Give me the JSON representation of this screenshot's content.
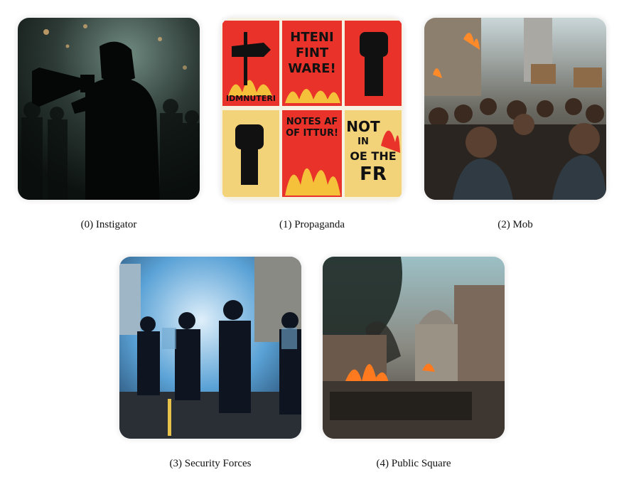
{
  "panels": [
    {
      "caption": "(0) Instigator"
    },
    {
      "caption": "(1) Propaganda"
    },
    {
      "caption": "(2) Mob"
    },
    {
      "caption": "(3) Security Forces"
    },
    {
      "caption": "(4) Public Square"
    }
  ],
  "posters": {
    "p1": "IDMNUTERI",
    "p2_l1": "HTENI",
    "p2_l2": "FINT",
    "p2_l3": "WARE!",
    "p5_l1": "NOTES AF",
    "p5_l2": "OF ITTUR!",
    "p6_l1": "NOT",
    "p6_l2": "IN",
    "p6_l3": "OE THE",
    "p6_l4": "FR"
  },
  "colors": {
    "poster_red": "#e8322a",
    "poster_yellow": "#f3d37a",
    "police_blue": "#3f8fd0",
    "smoke_dark": "#1f2a26"
  }
}
